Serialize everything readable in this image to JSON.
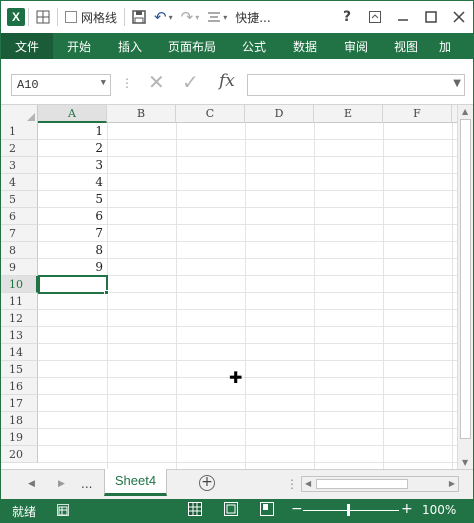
{
  "title_bar": {
    "app_icon": "excel-icon",
    "app_icon_letter": "X",
    "gridlines_label": "网格线",
    "quick_access_label": "快捷...",
    "help_label": "?",
    "icons": [
      "layout-grid-icon",
      "save-icon",
      "undo-icon",
      "redo-icon",
      "alignment-icon",
      "restore-ribbon-icon",
      "minimize-icon",
      "maximize-icon",
      "close-icon"
    ]
  },
  "ribbon": {
    "tabs": [
      {
        "label": "文件",
        "active": true
      },
      {
        "label": "开始",
        "active": false
      },
      {
        "label": "插入",
        "active": false
      },
      {
        "label": "页面布局",
        "active": false
      },
      {
        "label": "公式",
        "active": false
      },
      {
        "label": "数据",
        "active": false
      },
      {
        "label": "审阅",
        "active": false
      },
      {
        "label": "视图",
        "active": false
      },
      {
        "label": "加",
        "active": false
      }
    ]
  },
  "formula_bar": {
    "name_box": "A10",
    "fx_label": "fx",
    "formula_value": ""
  },
  "grid": {
    "columns": [
      "A",
      "B",
      "C",
      "D",
      "E",
      "F"
    ],
    "selected_column": "A",
    "rows": [
      "1",
      "2",
      "3",
      "4",
      "5",
      "6",
      "7",
      "8",
      "9",
      "10",
      "11",
      "12",
      "13",
      "14",
      "15",
      "16",
      "17",
      "18",
      "19",
      "20"
    ],
    "selected_row": "10",
    "column_a_values": [
      "1",
      "2",
      "3",
      "4",
      "5",
      "6",
      "7",
      "8",
      "9",
      "",
      "",
      "",
      "",
      "",
      "",
      "",
      "",
      "",
      "",
      ""
    ],
    "active_cell": "A10"
  },
  "sheet_tabs": {
    "more_label": "...",
    "sheets": [
      "Sheet4"
    ],
    "active_sheet": "Sheet4",
    "add_label": "+"
  },
  "status_bar": {
    "ready_label": "就绪",
    "zoom_minus": "−",
    "zoom_plus": "+",
    "zoom_value": "100%",
    "zoom_level_percent": 100
  },
  "colors": {
    "accent": "#217346",
    "accent_dark": "#1a5c37"
  }
}
